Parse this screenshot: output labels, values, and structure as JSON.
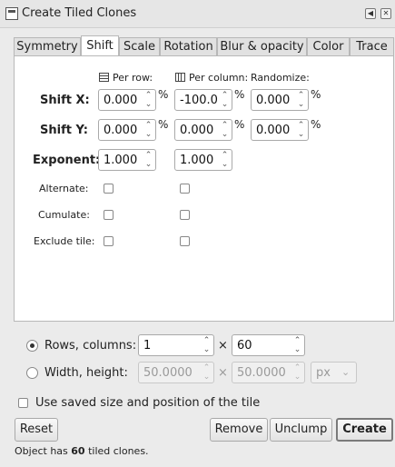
{
  "window": {
    "title": "Create Tiled Clones"
  },
  "tabs": [
    {
      "label": "Symmetry"
    },
    {
      "label": "Shift"
    },
    {
      "label": "Scale"
    },
    {
      "label": "Rotation"
    },
    {
      "label": "Blur & opacity"
    },
    {
      "label": "Color"
    },
    {
      "label": "Trace"
    }
  ],
  "active_tab": "Shift",
  "columns": {
    "per_row": "Per row:",
    "per_column": "Per column:",
    "randomize": "Randomize:"
  },
  "shift_x": {
    "label": "Shift X:",
    "per_row": "0.000",
    "per_column": "-100.0",
    "randomize": "0.000"
  },
  "shift_y": {
    "label": "Shift Y:",
    "per_row": "0.000",
    "per_column": "0.000",
    "randomize": "0.000"
  },
  "exponent": {
    "label": "Exponent:",
    "per_row": "1.000",
    "per_column": "1.000"
  },
  "percent": "%",
  "alternate": {
    "label": "Alternate:",
    "per_row": false,
    "per_column": false
  },
  "cumulate": {
    "label": "Cumulate:",
    "per_row": false,
    "per_column": false
  },
  "exclude_tile": {
    "label": "Exclude tile:",
    "per_row": false,
    "per_column": false
  },
  "rows_columns": {
    "label": "Rows, columns:",
    "selected": true,
    "rows": "1",
    "columns": "60",
    "times": "×"
  },
  "width_height": {
    "label": "Width, height:",
    "selected": false,
    "width": "50.0000",
    "height": "50.0000",
    "times": "×",
    "unit": "px"
  },
  "use_saved": {
    "label": "Use saved size and position of the tile",
    "checked": false
  },
  "buttons": {
    "reset": "Reset",
    "remove": "Remove",
    "unclump": "Unclump",
    "create": "Create"
  },
  "status": {
    "prefix": "Object has ",
    "count": "60",
    "suffix": " tiled clones."
  }
}
